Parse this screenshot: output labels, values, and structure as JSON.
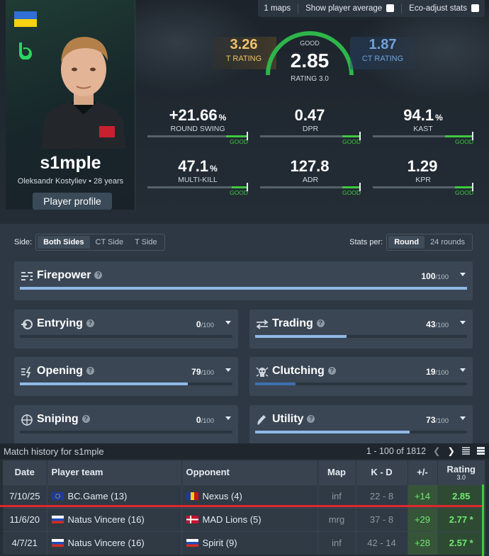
{
  "toolbar": {
    "maps": "1 maps",
    "show_average": "Show player average",
    "eco_adjust": "Eco-adjust stats"
  },
  "player": {
    "nickname": "s1mple",
    "fullname": "Oleksandr Kostyliev",
    "age": "28 years",
    "profile_button": "Player profile"
  },
  "ratings": {
    "t": {
      "value": "3.26",
      "label": "T RATING"
    },
    "main": {
      "badge": "GOOD",
      "value": "2.85",
      "label": "RATING 3.0"
    },
    "ct": {
      "value": "1.87",
      "label": "CT RATING"
    }
  },
  "stats": [
    {
      "value": "+21.66",
      "unit": "%",
      "label": "ROUND SWING",
      "badge": "GOOD",
      "fill": 0.22
    },
    {
      "value": "0.47",
      "unit": "",
      "label": "DPR",
      "badge": "GOOD",
      "fill": 0.18
    },
    {
      "value": "94.1",
      "unit": "%",
      "label": "KAST",
      "badge": "GOOD",
      "fill": 0.28
    },
    {
      "value": "47.1",
      "unit": "%",
      "label": "MULTI-KILL",
      "badge": "GOOD",
      "fill": 0.16
    },
    {
      "value": "127.8",
      "unit": "",
      "label": "ADR",
      "badge": "GOOD",
      "fill": 0.18
    },
    {
      "value": "1.29",
      "unit": "",
      "label": "KPR",
      "badge": "GOOD",
      "fill": 0.18
    }
  ],
  "side": {
    "label": "Side:",
    "options": [
      "Both Sides",
      "CT Side",
      "T Side"
    ],
    "active": "Both Sides"
  },
  "stats_per": {
    "label": "Stats per:",
    "options": [
      "Round",
      "24 rounds"
    ],
    "active": "Round"
  },
  "categories": {
    "firepower": {
      "name": "Firepower",
      "score": "100",
      "of": "/100",
      "level": 1.0
    },
    "entrying": {
      "name": "Entrying",
      "score": "0",
      "of": "/100",
      "level": 0.0
    },
    "trading": {
      "name": "Trading",
      "score": "43",
      "of": "/100",
      "level": 0.43
    },
    "opening": {
      "name": "Opening",
      "score": "79",
      "of": "/100",
      "level": 0.79
    },
    "clutching": {
      "name": "Clutching",
      "score": "19",
      "of": "/100",
      "level": 0.19
    },
    "sniping": {
      "name": "Sniping",
      "score": "0",
      "of": "/100",
      "level": 0.0
    },
    "utility": {
      "name": "Utility",
      "score": "73",
      "of": "/100",
      "level": 0.73
    }
  },
  "match_history": {
    "title": "Match history for s1mple",
    "range": "1 - 100 of 1812",
    "headers": {
      "date": "Date",
      "team": "Player team",
      "opponent": "Opponent",
      "map": "Map",
      "kd": "K - D",
      "pm": "+/-",
      "rating": "Rating",
      "rating_sub": "3.0"
    },
    "rows": [
      {
        "date": "7/10/25",
        "team": "BC.Game (13)",
        "team_flag": "eu",
        "opponent": "Nexus (4)",
        "opp_flag": "ro",
        "map": "inf",
        "kd": "22 - 8",
        "pm": "+14",
        "rating": "2.85"
      },
      {
        "date": "11/6/20",
        "team": "Natus Vincere (16)",
        "team_flag": "ru",
        "opponent": "MAD Lions (5)",
        "opp_flag": "dk",
        "map": "mrg",
        "kd": "37 - 8",
        "pm": "+29",
        "rating": "2.77 *"
      },
      {
        "date": "4/7/21",
        "team": "Natus Vincere (16)",
        "team_flag": "ru",
        "opponent": "Spirit (9)",
        "opp_flag": "ru",
        "map": "inf",
        "kd": "42 - 14",
        "pm": "+28",
        "rating": "2.57 *"
      }
    ]
  },
  "colors": {
    "good": "#3fc83f",
    "t": "#f0c36a",
    "ct": "#6fa2dd",
    "accent_bar": "#8fb8e6",
    "highlight_line": "#e0262b"
  }
}
